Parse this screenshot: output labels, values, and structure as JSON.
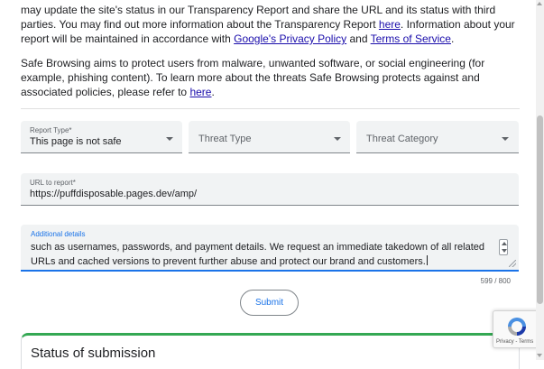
{
  "intro": {
    "p1_part1": "may update the site's status in our Transparency Report and share the URL and its status with third parties. You may find out more information about the Transparency Report ",
    "p1_link1": "here",
    "p1_part2": ". Information about your report will be maintained in accordance with ",
    "p1_link2": "Google's Privacy Policy",
    "p1_part3": " and ",
    "p1_link3": "Terms of Service",
    "p1_part4": ".",
    "p2_part1": "Safe Browsing aims to protect users from malware, unwanted software, or social engineering (for example, phishing content). To learn more about the threats Safe Browsing protects against and associated policies, please refer to ",
    "p2_link": "here",
    "p2_part2": "."
  },
  "form": {
    "report_type": {
      "label": "Report Type*",
      "value": "This page is not safe"
    },
    "threat_type": {
      "placeholder": "Threat Type"
    },
    "threat_category": {
      "placeholder": "Threat Category"
    },
    "url": {
      "label": "URL to report*",
      "value": "https://puffdisposable.pages.dev/amp/"
    },
    "details": {
      "label": "Additional details",
      "line1": "such as usernames, passwords, and payment details. We request an immediate takedown of all related",
      "line2": "URLs and cached versions to prevent further abuse and protect our brand and customers."
    },
    "counter": "599 / 800",
    "submit_label": "Submit"
  },
  "status": {
    "title": "Status of submission"
  },
  "recaptcha": {
    "links": "Privacy - Terms"
  },
  "colors": {
    "accent": "#1a73e8",
    "link": "#1a0dab",
    "status_border": "#34a853",
    "field_bg": "#f1f3f4"
  }
}
